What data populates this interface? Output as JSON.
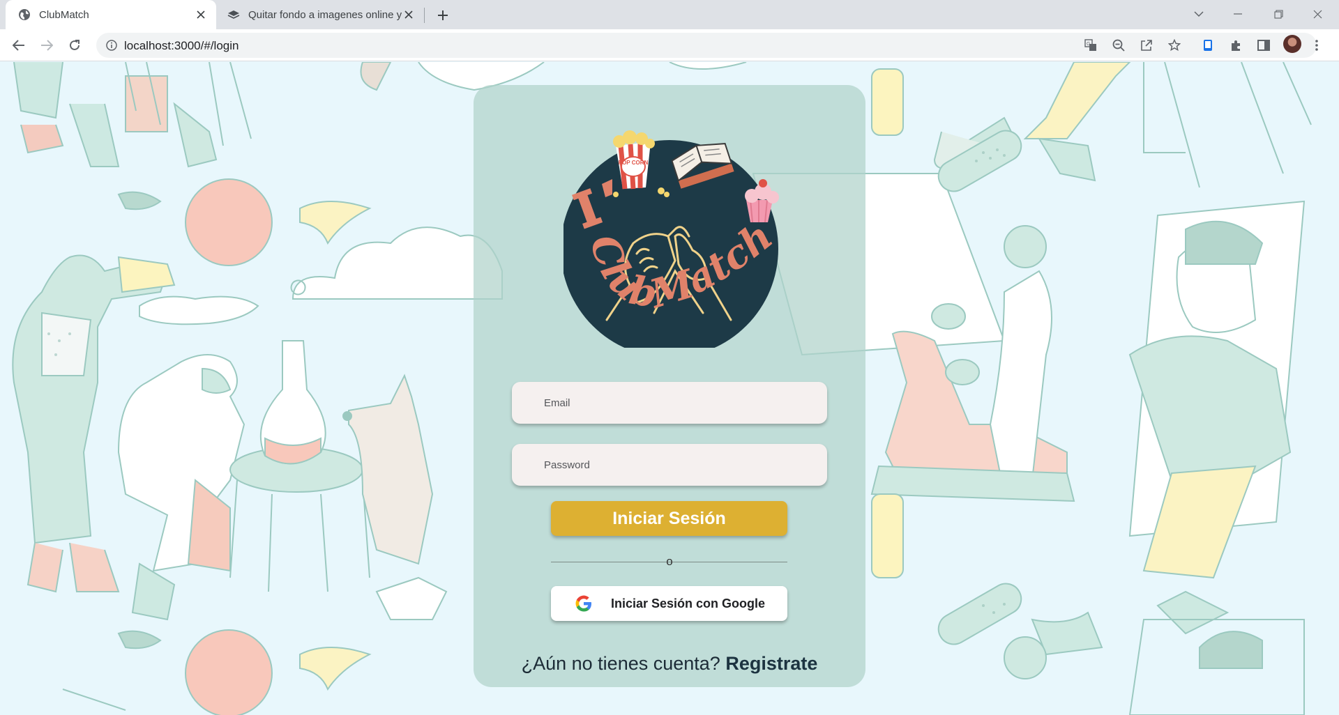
{
  "browser": {
    "tabs": [
      {
        "title": "ClubMatch",
        "active": true
      },
      {
        "title": "Quitar fondo a imagenes online y",
        "active": false
      }
    ],
    "url": "localhost:3000/#/login"
  },
  "login": {
    "logo_text": "ClubMatch",
    "logo_popcorn_text": "POP CORN",
    "email_placeholder": "Email",
    "password_placeholder": "Password",
    "login_button": "Iniciar Sesión",
    "divider_text": "o",
    "google_button": "Iniciar Sesión con Google",
    "signup_prompt": "¿Aún no tienes cuenta?",
    "signup_link": "Registrate"
  },
  "colors": {
    "card": "#b0d2ca",
    "login_button": "#ddb032",
    "logo_circle": "#1d3a47",
    "logo_text": "#e0826a",
    "background": "#e8f7fc"
  },
  "icons": [
    "globe-icon",
    "layers-icon",
    "close-icon",
    "plus-icon",
    "back-icon",
    "forward-icon",
    "reload-icon",
    "info-icon",
    "translate-icon",
    "zoom-out-icon",
    "share-icon",
    "star-icon",
    "side-panel-icon",
    "extensions-icon",
    "sidebar-icon",
    "more-icon",
    "google-icon"
  ]
}
